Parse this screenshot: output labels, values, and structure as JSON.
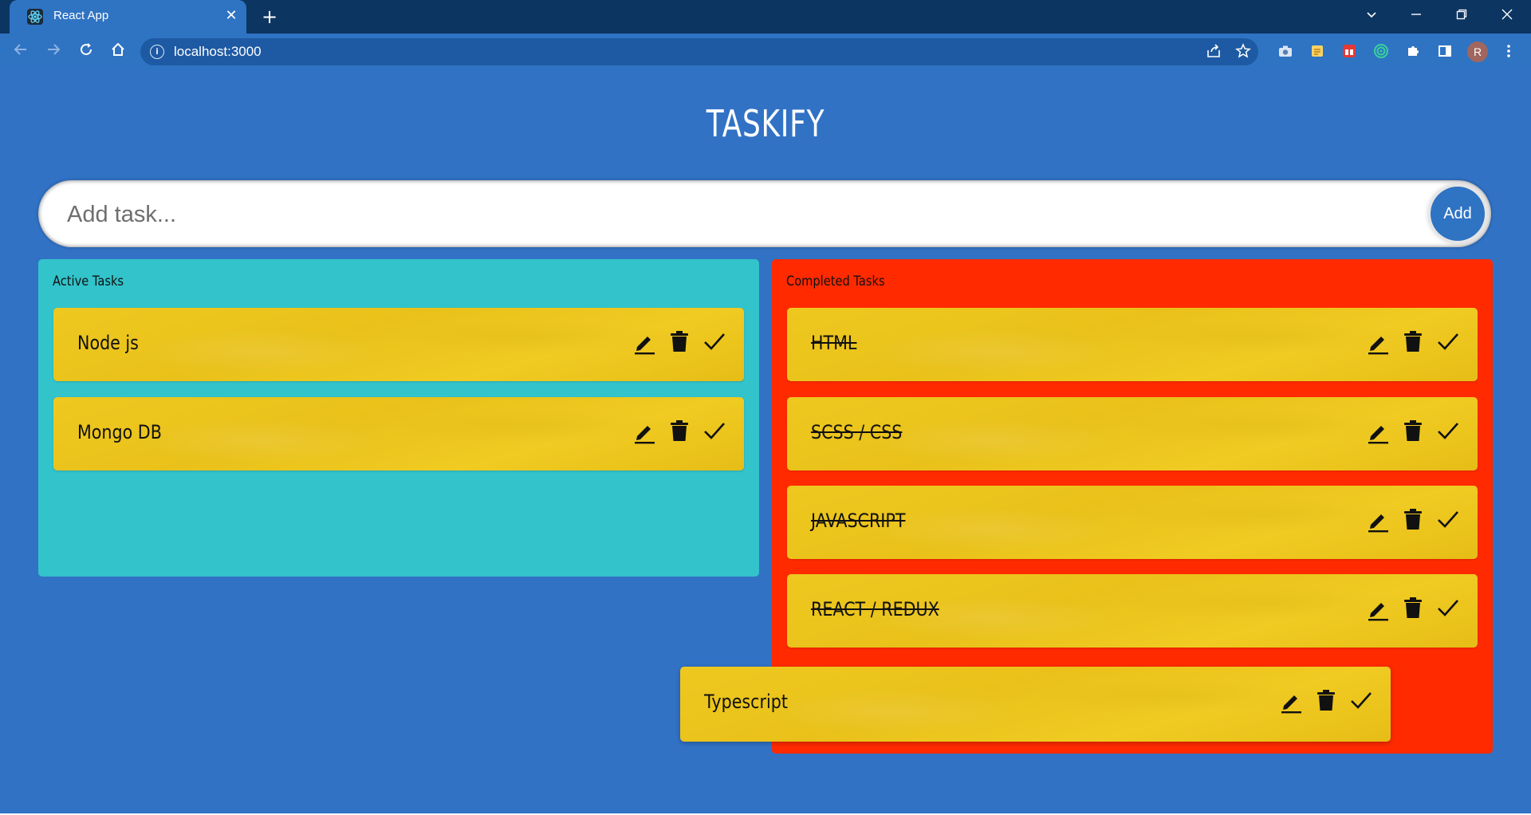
{
  "browser": {
    "tab_title": "React App",
    "tab_close": "✕",
    "new_tab": "+",
    "url": "localhost:3000",
    "profile_initial": "R",
    "icons": {
      "favicon": "react-logo-icon",
      "back": "arrow-left-icon",
      "forward": "arrow-right-icon",
      "reload": "reload-icon",
      "home": "home-icon",
      "info": "info-icon",
      "share": "share-icon",
      "bookmark": "star-icon",
      "extensions": [
        "camera-icon",
        "notes-icon",
        "gift-icon",
        "target-icon",
        "puzzle-icon",
        "side-panel-icon"
      ],
      "menu": "kebab-menu-icon"
    }
  },
  "app": {
    "title": "TASKIFY",
    "input": {
      "placeholder": "Add task...",
      "value": ""
    },
    "add_button": "Add",
    "colors": {
      "background": "#3172c5",
      "active": "#32c3cb",
      "completed": "#ff2a00",
      "card": "#eec81f"
    },
    "columns": {
      "active": {
        "heading": "Active Tasks",
        "tasks": [
          "Node js",
          "Mongo DB"
        ]
      },
      "completed": {
        "heading": "Completed Tasks",
        "tasks": [
          "HTML",
          "SCSS / CSS",
          "JAVASCRIPT",
          "REACT / REDUX"
        ]
      }
    },
    "dragging_task": "Typescript",
    "task_actions": [
      "edit-icon",
      "delete-icon",
      "check-icon"
    ]
  }
}
